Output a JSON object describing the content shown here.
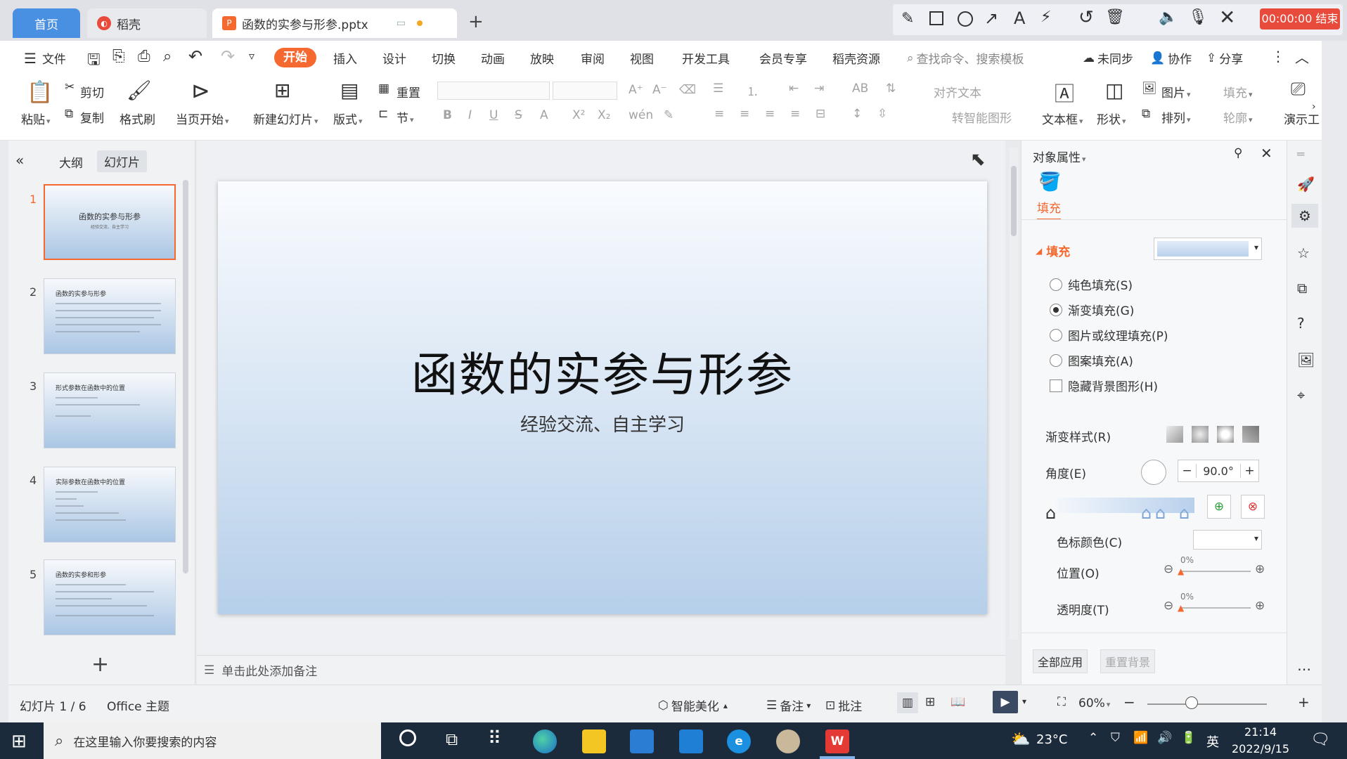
{
  "tabs": {
    "home": "首页",
    "daoke": "稻壳",
    "doc_title": "函数的实参与形参.pptx",
    "new_tab": "+"
  },
  "recording": {
    "timer_label": "00:00:00 结束"
  },
  "menu": {
    "file": "文件",
    "items": [
      "开始",
      "插入",
      "设计",
      "切换",
      "动画",
      "放映",
      "审阅",
      "视图",
      "开发工具",
      "会员专享",
      "稻壳资源"
    ],
    "search_placeholder": "查找命令、搜索模板",
    "sync": "未同步",
    "collab": "协作",
    "share": "分享"
  },
  "ribbon": {
    "paste": "粘贴",
    "cut": "剪切",
    "copy": "复制",
    "format_painter": "格式刷",
    "play_from_current": "当页开始",
    "new_slide": "新建幻灯片",
    "layout": "版式",
    "reset": "重置",
    "section": "节",
    "align_text": "对齐文本",
    "smart_art": "转智能图形",
    "textbox": "文本框",
    "shape": "形状",
    "picture": "图片",
    "arrange": "排列",
    "fill": "填充",
    "outline": "轮廓",
    "presenter": "演示工"
  },
  "left_panel": {
    "tab_outline": "大纲",
    "tab_slides": "幻灯片",
    "thumbs": [
      {
        "num": "1",
        "title": "函数的实参与形参",
        "subtitle": "经验交流、自主学习"
      },
      {
        "num": "2",
        "title": "函数的实参与形参"
      },
      {
        "num": "3",
        "title": "形式参数在函数中的位置"
      },
      {
        "num": "4",
        "title": "实际参数在函数中的位置"
      },
      {
        "num": "5",
        "title": "函数的实参和形参"
      }
    ],
    "add": "+"
  },
  "slide": {
    "title": "函数的实参与形参",
    "subtitle": "经验交流、自主学习"
  },
  "notes": {
    "placeholder": "单击此处添加备注"
  },
  "properties": {
    "header": "对象属性",
    "tab_fill": "填充",
    "section_fill": "填充",
    "options": [
      "纯色填充(S)",
      "渐变填充(G)",
      "图片或纹理填充(P)",
      "图案填充(A)"
    ],
    "selected_index": 1,
    "hide_bg": "隐藏背景图形(H)",
    "gradient_style": "渐变样式(R)",
    "angle_label": "角度(E)",
    "angle_value": "90.0°",
    "stop_color": "色标颜色(C)",
    "position_label": "位置(O)",
    "position_value": "0%",
    "transparency_label": "透明度(T)",
    "transparency_value": "0%",
    "apply_all": "全部应用",
    "reset_bg": "重置背景",
    "fill_color": "#c8dcf2"
  },
  "status": {
    "slide_count": "幻灯片 1 / 6",
    "theme": "Office 主题",
    "beautify": "智能美化",
    "notes": "备注",
    "comments": "批注",
    "zoom": "60%"
  },
  "taskbar": {
    "search_placeholder": "在这里输入你要搜索的内容",
    "weather": "23°C",
    "lang": "英",
    "time": "21:14",
    "date": "2022/9/15"
  },
  "colors": {
    "accent": "#f5682f",
    "tab_home": "#4a90e2",
    "record": "#e84b3c",
    "taskbar": "#1c2b3c"
  }
}
